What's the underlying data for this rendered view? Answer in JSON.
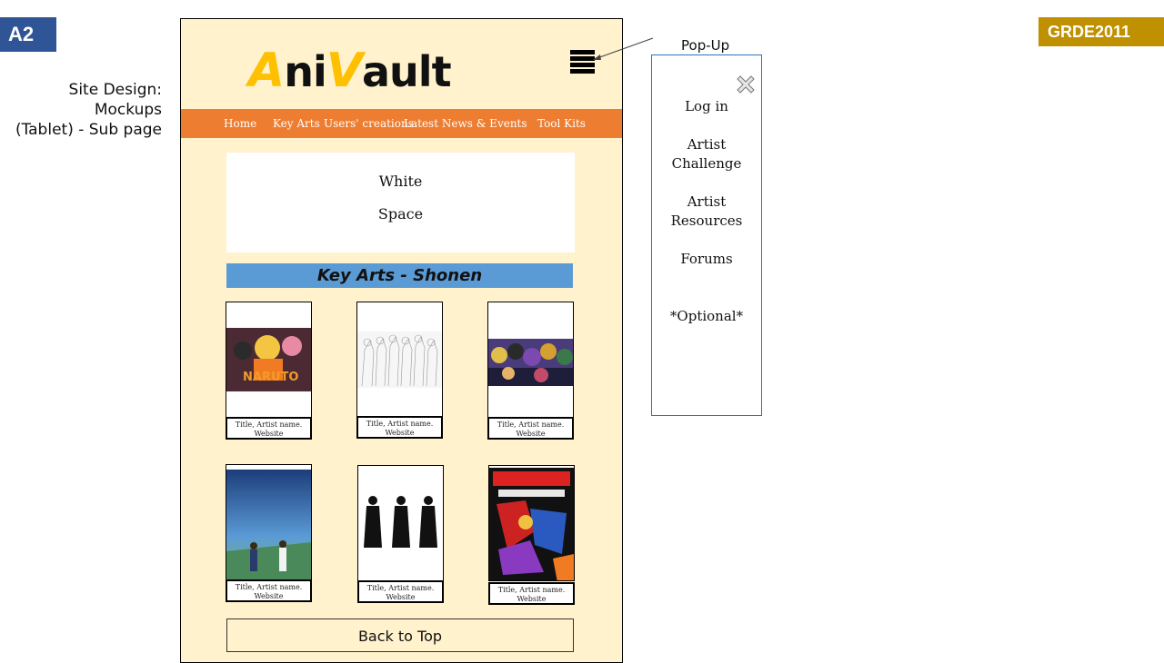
{
  "slide": {
    "tag": "A2",
    "course_code": "GRDE2011",
    "note_lines": [
      "Site Design:",
      "Mockups",
      "(Tablet) - Sub page"
    ]
  },
  "site": {
    "logo": {
      "accent_a": "A",
      "part1": "ni",
      "accent_v": "V",
      "part2": "ault"
    },
    "nav": [
      "Home",
      "Key Arts",
      "Users' creations",
      "Latest News & Events",
      "Tool Kits"
    ],
    "white_space": [
      "White",
      "Space"
    ],
    "section_title": "Key Arts - Shonen",
    "cards": [
      {
        "caption_line1": "Title, Artist name.",
        "caption_line2": "Website",
        "art": "naruto"
      },
      {
        "caption_line1": "Title, Artist name.",
        "caption_line2": "Website",
        "art": "sketch"
      },
      {
        "caption_line1": "Title, Artist name.",
        "caption_line2": "Website",
        "art": "group"
      },
      {
        "caption_line1": "Title, Artist name.",
        "caption_line2": "Website",
        "art": "sky"
      },
      {
        "caption_line1": "Title, Artist name.",
        "caption_line2": "Website",
        "art": "figures"
      },
      {
        "caption_line1": "Title, Artist name.",
        "caption_line2": "Website",
        "art": "cowboy"
      }
    ],
    "back_to_top": "Back to Top"
  },
  "popup": {
    "label": "Pop-Up",
    "items": [
      "Log in",
      "Artist Challenge",
      "Artist Resources",
      "Forums",
      "*Optional*"
    ]
  },
  "colors": {
    "tag_bg": "#2f5597",
    "code_bg": "#bf9000",
    "page_bg": "#fff2cc",
    "nav_bg": "#ed7d31",
    "section_bg": "#5b9bd5",
    "logo_accent": "#ffc000",
    "popup_border": "#2e75b6"
  }
}
